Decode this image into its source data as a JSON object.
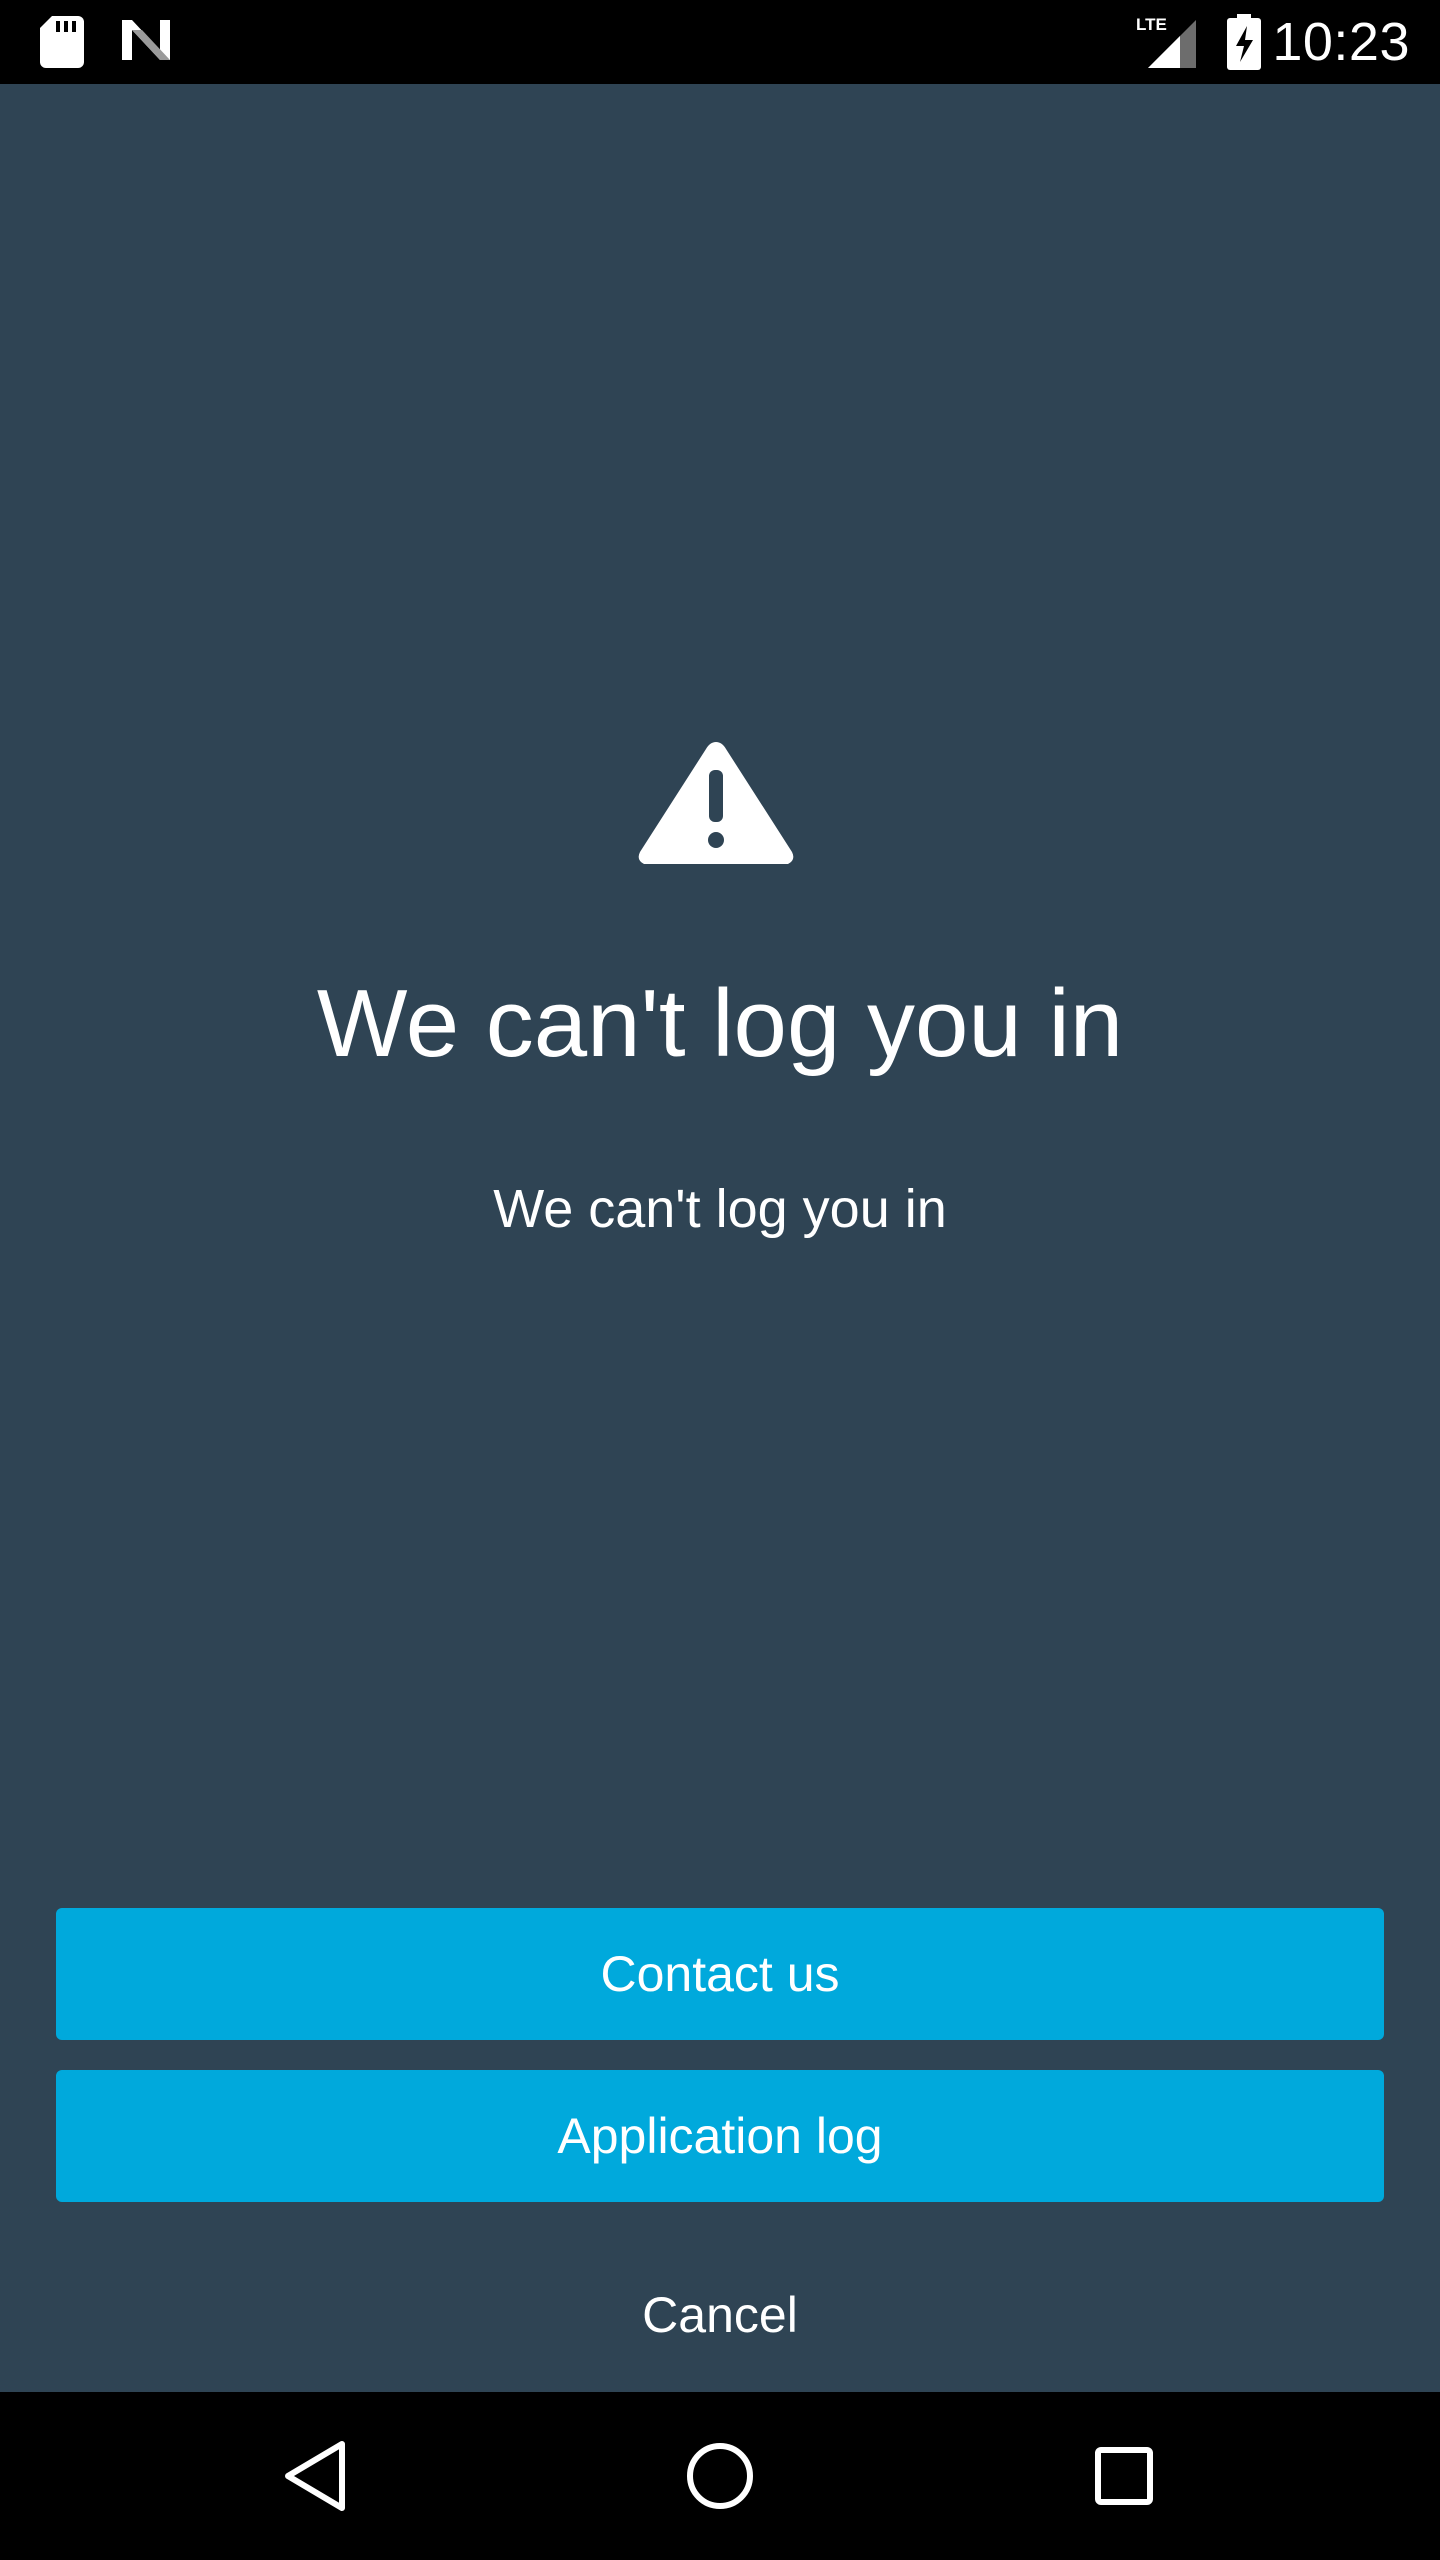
{
  "status_bar": {
    "time": "10:23",
    "network_label": "LTE",
    "icons": [
      "sd-card-icon",
      "n-notification-icon",
      "lte-signal-icon",
      "battery-charging-icon"
    ]
  },
  "error": {
    "icon": "warning-icon",
    "title": "We can't log you in",
    "message": "We can't log you in"
  },
  "actions": {
    "contact_label": "Contact us",
    "log_label": "Application log",
    "cancel_label": "Cancel"
  },
  "nav_bar": {
    "icons": [
      "back-icon",
      "home-icon",
      "recents-icon"
    ]
  },
  "colors": {
    "background": "#2f4454",
    "button": "#00a9dc",
    "text": "#ffffff"
  }
}
